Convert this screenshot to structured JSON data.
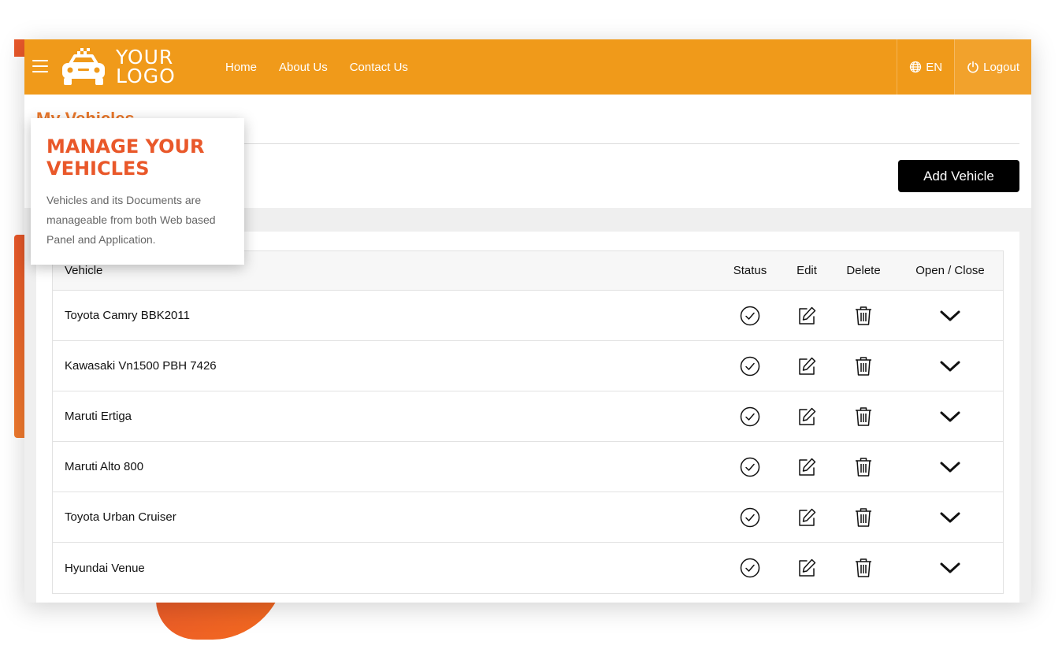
{
  "colors": {
    "header_bg": "#f09a1a",
    "accent_title": "#e9772a",
    "popup_title": "#e9582a",
    "button_bg": "#000000"
  },
  "header": {
    "menu_icon": "hamburger-icon",
    "logo": {
      "icon": "taxi-car-icon",
      "line1": "YOUR",
      "line2": "LOGO"
    },
    "nav": [
      {
        "label": "Home"
      },
      {
        "label": "About Us"
      },
      {
        "label": "Contact Us"
      }
    ],
    "language": {
      "icon": "globe-icon",
      "label": "EN"
    },
    "logout": {
      "icon": "power-icon",
      "label": "Logout"
    }
  },
  "page": {
    "title": "My Vehicles",
    "add_button": "Add Vehicle"
  },
  "table": {
    "headers": {
      "vehicle": "Vehicle",
      "status": "Status",
      "edit": "Edit",
      "delete": "Delete",
      "open_close": "Open / Close"
    },
    "rows": [
      {
        "vehicle": "Toyota Camry BBK2011"
      },
      {
        "vehicle": "Kawasaki Vn1500 PBH 7426"
      },
      {
        "vehicle": "Maruti Ertiga"
      },
      {
        "vehicle": "Maruti Alto 800"
      },
      {
        "vehicle": "Toyota Urban Cruiser"
      },
      {
        "vehicle": "Hyundai Venue"
      }
    ],
    "row_icons": {
      "status": "check-circle-icon",
      "edit": "edit-icon",
      "delete": "trash-icon",
      "toggle": "chevron-down-icon"
    }
  },
  "popup": {
    "title_line1": "MANAGE YOUR",
    "title_line2": "VEHICLES",
    "body": "Vehicles and its Documents are manageable from both Web based Panel and Application."
  }
}
